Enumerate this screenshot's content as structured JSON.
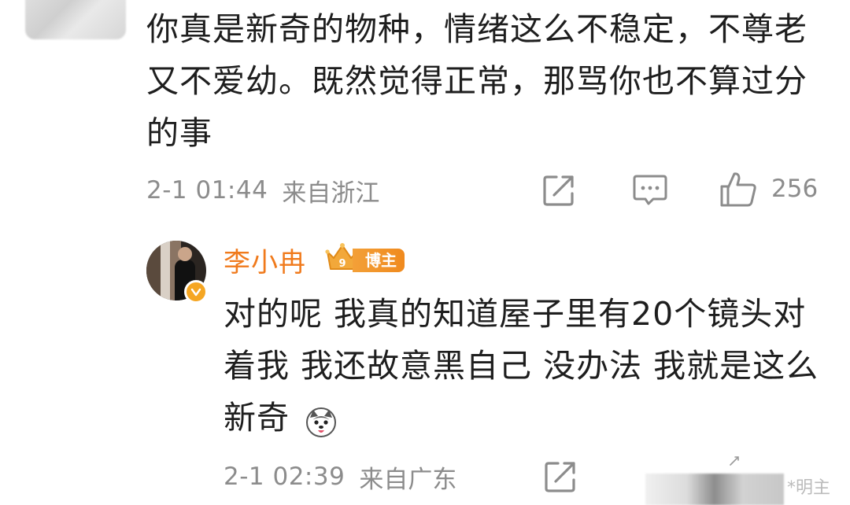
{
  "top_comment": {
    "text": "你真是新奇的物种，情绪这么不稳定，不尊老又不爱幼。既然觉得正常，那骂你也不算过分的事",
    "time": "2-1 01:44",
    "location": "来自浙江",
    "like_count": "256",
    "icons": {
      "share": "share-icon",
      "comment": "comment-icon",
      "like": "thumbs-up-icon"
    }
  },
  "reply": {
    "author_name": "李小冉",
    "author_badge": "博主",
    "crown_level": "9",
    "text": "对的呢 我真的知道屋子里有20个镜头对着我 我还故意黑自己 没办法 我就是这么新奇",
    "emoji": "husky-emoji",
    "time": "2-1 02:39",
    "location": "来自广东"
  },
  "watermark": "*明主",
  "colors": {
    "accent_name": "#f07a1c",
    "meta_gray": "#8c8c8c",
    "badge_orange": "#f3a038",
    "verified": "#f5a623"
  }
}
